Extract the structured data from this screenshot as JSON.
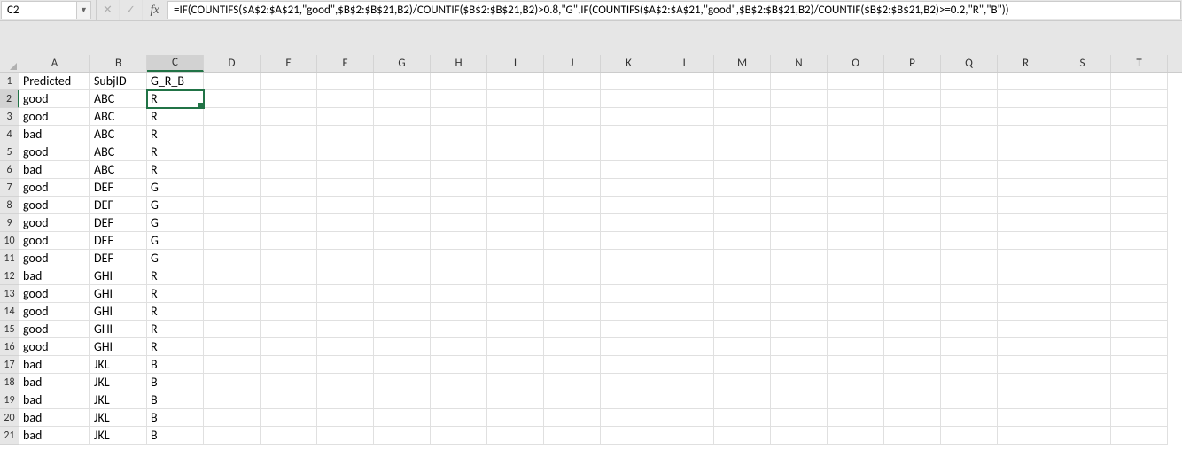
{
  "nameBox": "C2",
  "formula": "=IF(COUNTIFS($A$2:$A$21,\"good\",$B$2:$B$21,B2)/COUNTIF($B$2:$B$21,B2)>0.8,\"G\",IF(COUNTIFS($A$2:$A$21,\"good\",$B$2:$B$21,B2)/COUNTIF($B$2:$B$21,B2)>=0.2,\"R\",\"B\"))",
  "fxLabel": "fx",
  "columns": [
    "A",
    "B",
    "C",
    "D",
    "E",
    "F",
    "G",
    "H",
    "I",
    "J",
    "K",
    "L",
    "M",
    "N",
    "O",
    "P",
    "Q",
    "R",
    "S",
    "T"
  ],
  "wideCols": [
    "A"
  ],
  "activeCol": "C",
  "activeRow": 2,
  "selectedCell": "C2",
  "rowCount": 21,
  "headers": {
    "A": "Predicted",
    "B": "SubjID",
    "C": "G_R_B"
  },
  "data": [
    {
      "A": "good",
      "B": "ABC",
      "C": "R"
    },
    {
      "A": "good",
      "B": "ABC",
      "C": "R"
    },
    {
      "A": "bad",
      "B": "ABC",
      "C": "R"
    },
    {
      "A": "good",
      "B": "ABC",
      "C": "R"
    },
    {
      "A": "bad",
      "B": "ABC",
      "C": "R"
    },
    {
      "A": "good",
      "B": "DEF",
      "C": "G"
    },
    {
      "A": "good",
      "B": "DEF",
      "C": "G"
    },
    {
      "A": "good",
      "B": "DEF",
      "C": "G"
    },
    {
      "A": "good",
      "B": "DEF",
      "C": "G"
    },
    {
      "A": "good",
      "B": "DEF",
      "C": "G"
    },
    {
      "A": "bad",
      "B": "GHI",
      "C": "R"
    },
    {
      "A": "good",
      "B": "GHI",
      "C": "R"
    },
    {
      "A": "good",
      "B": "GHI",
      "C": "R"
    },
    {
      "A": "good",
      "B": "GHI",
      "C": "R"
    },
    {
      "A": "good",
      "B": "GHI",
      "C": "R"
    },
    {
      "A": "bad",
      "B": "JKL",
      "C": "B"
    },
    {
      "A": "bad",
      "B": "JKL",
      "C": "B"
    },
    {
      "A": "bad",
      "B": "JKL",
      "C": "B"
    },
    {
      "A": "bad",
      "B": "JKL",
      "C": "B"
    },
    {
      "A": "bad",
      "B": "JKL",
      "C": "B"
    }
  ]
}
